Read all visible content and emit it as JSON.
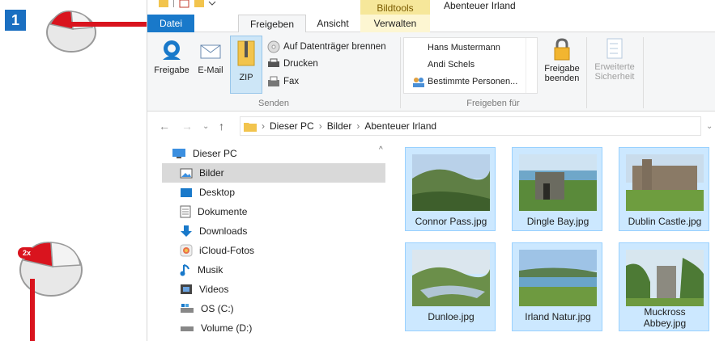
{
  "tutorial": {
    "step_number": "1",
    "double_click_badge": "2x"
  },
  "window": {
    "contextual_tab_group": "Bildtools",
    "title": "Abenteuer Irland",
    "tabs": [
      {
        "label": "Datei"
      },
      {
        "label": "Freigeben"
      },
      {
        "label": "Ansicht"
      },
      {
        "label": "Verwalten"
      }
    ]
  },
  "ribbon": {
    "freigabe_label": "Freigabe",
    "email_label": "E-Mail",
    "zip_label": "ZIP",
    "burn_label": "Auf Datenträger brennen",
    "print_label": "Drucken",
    "fax_label": "Fax",
    "group_senden": "Senden",
    "people": [
      "Hans Mustermann",
      "Andi Schels",
      "Bestimmte Personen..."
    ],
    "stop_sharing_label_1": "Freigabe",
    "stop_sharing_label_2": "beenden",
    "advanced_label_1": "Erweiterte",
    "advanced_label_2": "Sicherheit",
    "group_freigeben_fuer": "Freigeben für"
  },
  "address": {
    "crumbs": [
      "Dieser PC",
      "Bilder",
      "Abenteuer Irland"
    ]
  },
  "nav": {
    "items": [
      {
        "label": "Dieser PC",
        "icon": "pc-icon"
      },
      {
        "label": "Bilder",
        "icon": "pictures-icon"
      },
      {
        "label": "Desktop",
        "icon": "desktop-icon"
      },
      {
        "label": "Dokumente",
        "icon": "documents-icon"
      },
      {
        "label": "Downloads",
        "icon": "download-icon"
      },
      {
        "label": "iCloud-Fotos",
        "icon": "icloud-photos-icon"
      },
      {
        "label": "Musik",
        "icon": "music-icon"
      },
      {
        "label": "Videos",
        "icon": "video-icon"
      },
      {
        "label": "OS (C:)",
        "icon": "drive-c-icon"
      },
      {
        "label": "Volume (D:)",
        "icon": "drive-d-icon"
      }
    ]
  },
  "files": [
    {
      "name": "Connor Pass.jpg"
    },
    {
      "name": "Dingle Bay.jpg"
    },
    {
      "name": "Dublin Castle.jpg"
    },
    {
      "name": "Dunloe.jpg"
    },
    {
      "name": "Irland Natur.jpg"
    },
    {
      "name": "Muckross",
      "name2": "Abbey.jpg"
    }
  ],
  "colors": {
    "accent": "#1979ca",
    "selection": "#cce8ff",
    "arrow": "#d9141e",
    "contextual": "#f6e79a"
  }
}
